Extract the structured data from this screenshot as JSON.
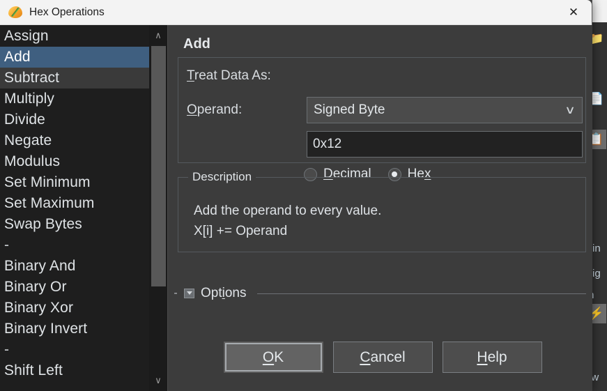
{
  "window": {
    "title": "Hex Operations",
    "app_icon": "hex-operations-icon",
    "close_label": "✕"
  },
  "operations_list": {
    "items": [
      {
        "label": "Assign",
        "state": "normal"
      },
      {
        "label": "Add",
        "state": "selected"
      },
      {
        "label": "Subtract",
        "state": "hover"
      },
      {
        "label": "Multiply",
        "state": "normal"
      },
      {
        "label": "Divide",
        "state": "normal"
      },
      {
        "label": "Negate",
        "state": "normal"
      },
      {
        "label": "Modulus",
        "state": "normal"
      },
      {
        "label": "Set Minimum",
        "state": "normal"
      },
      {
        "label": "Set Maximum",
        "state": "normal"
      },
      {
        "label": "Swap Bytes",
        "state": "normal"
      },
      {
        "label": "-",
        "state": "separator"
      },
      {
        "label": "Binary And",
        "state": "normal"
      },
      {
        "label": "Binary Or",
        "state": "normal"
      },
      {
        "label": "Binary Xor",
        "state": "normal"
      },
      {
        "label": "Binary Invert",
        "state": "normal"
      },
      {
        "label": "-",
        "state": "separator"
      },
      {
        "label": "Shift Left",
        "state": "normal"
      }
    ],
    "scrollbar": {
      "up_arrow": "∧",
      "down_arrow": "∨"
    }
  },
  "panel": {
    "title": "Add",
    "treat_data_as": {
      "label_pre": "",
      "label_accel": "T",
      "label_post": "reat Data As:",
      "value": "Signed Byte",
      "chevron": "∨"
    },
    "operand": {
      "label_accel": "O",
      "label_post": "perand:",
      "value": "0x12",
      "placeholder": ""
    },
    "radios": [
      {
        "id": "decimal",
        "accel": "D",
        "pre": "",
        "post": "ecimal",
        "checked": false
      },
      {
        "id": "hex",
        "accel": "x",
        "pre": "He",
        "post": "",
        "checked": true
      }
    ],
    "description": {
      "legend": "Description",
      "lines": [
        "Add the operand to every value.",
        "X[i] += Operand"
      ]
    },
    "options": {
      "minus": "-",
      "accel": "i",
      "pre": "Opt",
      "post": "ons",
      "expanded": false
    }
  },
  "buttons": [
    {
      "id": "ok",
      "pre": "",
      "accel": "O",
      "post": "K",
      "default": true
    },
    {
      "id": "cancel",
      "pre": "",
      "accel": "C",
      "post": "ancel",
      "default": false
    },
    {
      "id": "help",
      "pre": "",
      "accel": "H",
      "post": "elp",
      "default": false
    }
  ],
  "background_window": {
    "tool_icons": [
      "folder-icon",
      "note-icon",
      "copy-icon",
      "lightning-icon"
    ],
    "text_fragments": [
      "n",
      "Bin",
      "Sig",
      "In",
      "ow"
    ]
  },
  "colors": {
    "dialog_bg": "#3c3c3c",
    "list_bg": "#1e1e1e",
    "selection": "#3f5f80",
    "titlebar_bg": "#f3f3f3",
    "input_bg": "#222222",
    "text": "#dfe3e7"
  }
}
